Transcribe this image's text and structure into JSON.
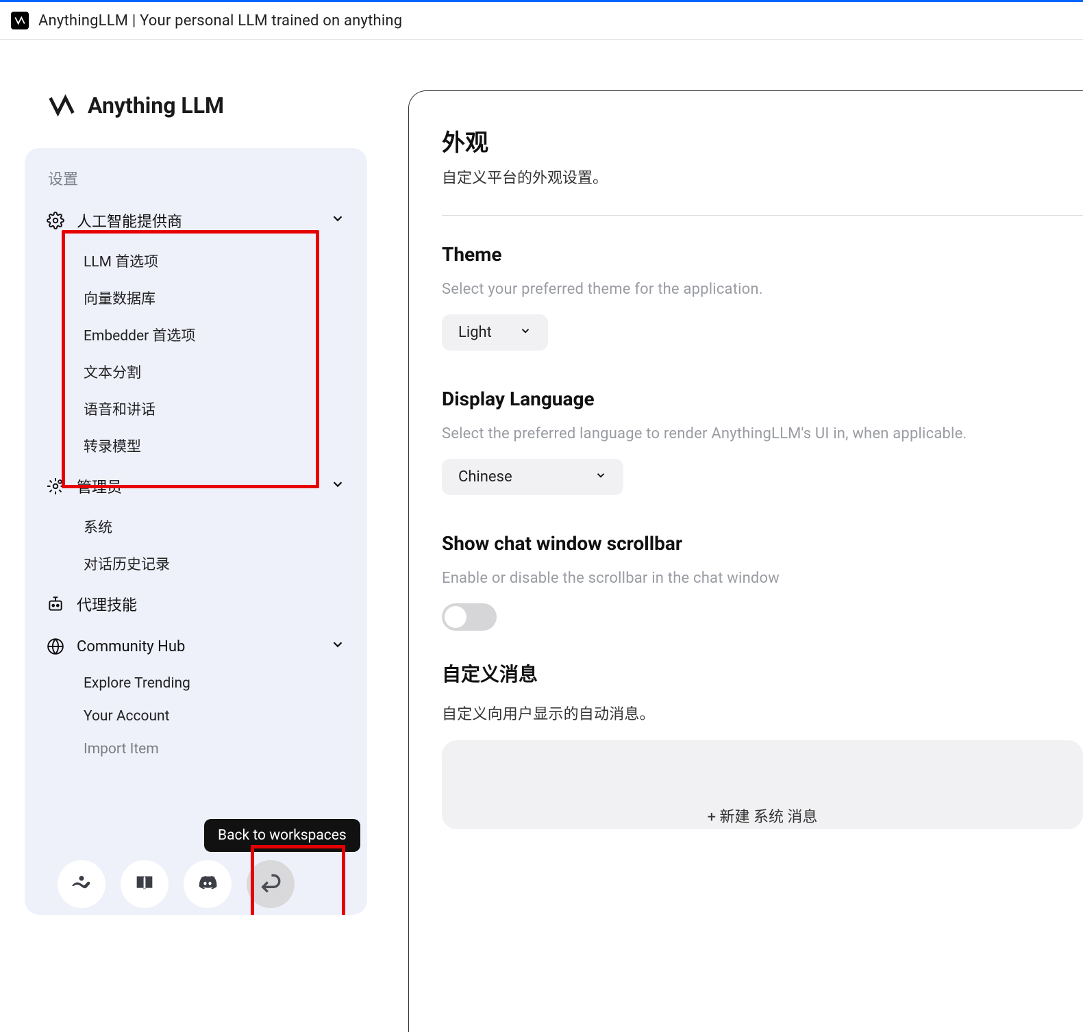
{
  "window": {
    "title": "AnythingLLM | Your personal LLM trained on anything"
  },
  "brand": {
    "name": "Anything LLM"
  },
  "sidebar": {
    "heading": "设置",
    "sections": {
      "ai": {
        "label": "人工智能提供商",
        "items": [
          "LLM 首选项",
          "向量数据库",
          "Embedder 首选项",
          "文本分割",
          "语音和讲话",
          "转录模型"
        ]
      },
      "admin": {
        "label": "管理员",
        "items": [
          "系统",
          "对话历史记录"
        ]
      },
      "agent": {
        "label": "代理技能"
      },
      "community": {
        "label": "Community Hub",
        "items": [
          "Explore Trending",
          "Your Account",
          "Import Item"
        ]
      }
    }
  },
  "tooltip": {
    "back": "Back to workspaces"
  },
  "main": {
    "title": "外观",
    "subtitle": "自定义平台的外观设置。",
    "theme": {
      "title": "Theme",
      "desc": "Select your preferred theme for the application.",
      "value": "Light"
    },
    "language": {
      "title": "Display Language",
      "desc": "Select the preferred language to render AnythingLLM's UI in, when applicable.",
      "value": "Chinese"
    },
    "scrollbar": {
      "title": "Show chat window scrollbar",
      "desc": "Enable or disable the scrollbar in the chat window"
    },
    "custom_msg": {
      "title": "自定义消息",
      "desc": "自定义向用户显示的自动消息。",
      "hint": "+ 新建 系统 消息"
    }
  }
}
